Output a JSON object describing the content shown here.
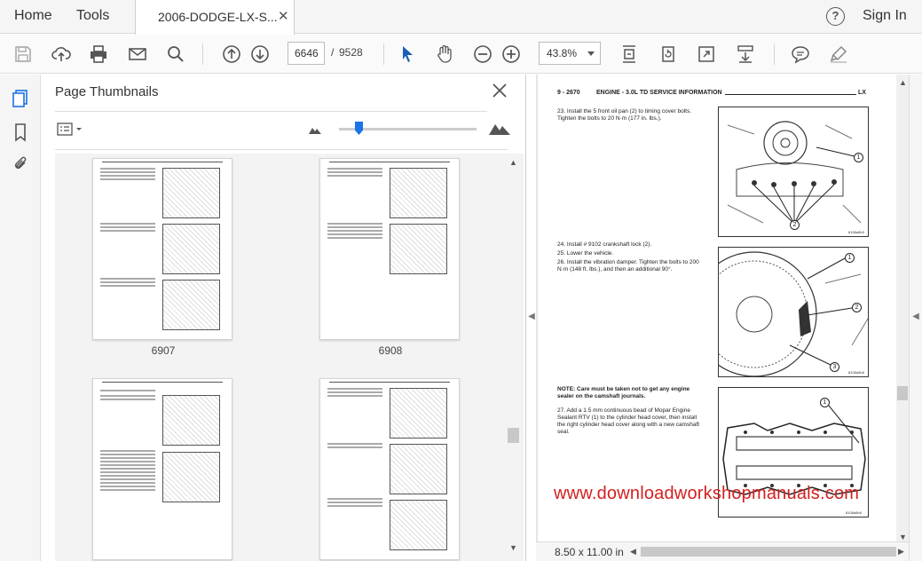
{
  "menubar": {
    "home": "Home",
    "tools": "Tools",
    "tab_title": "2006-DODGE-LX-S...",
    "help_label": "?",
    "sign_in": "Sign In"
  },
  "toolbar": {
    "current_page": "6646",
    "page_separator": "/",
    "page_count": "9528",
    "zoom": "43.8%",
    "icons": [
      "save-icon",
      "upload-icon",
      "print-icon",
      "email-icon",
      "search-icon",
      "page-up-icon",
      "page-down-icon",
      "select-cursor-icon",
      "hand-icon",
      "zoom-out-icon",
      "zoom-in-icon",
      "fit-page-icon",
      "rotate-icon",
      "full-screen-icon",
      "scroll-mode-icon",
      "comment-icon",
      "highlight-icon"
    ]
  },
  "panel": {
    "title": "Page Thumbnails",
    "thumbnails": [
      {
        "label": "6907"
      },
      {
        "label": "6908"
      },
      {
        "label": ""
      },
      {
        "label": ""
      }
    ]
  },
  "document": {
    "header_left": "9 - 2670",
    "header_center": "ENGINE - 3.0L TD SERVICE INFORMATION",
    "header_right": "LX",
    "steps": [
      {
        "text": "23. Install the 5 front oil pan (2) to timing cover bolts. Tighten the bolts to 20 N·m (177 in. lbs.)."
      },
      {
        "text": "24. Install # 9102 crankshaft lock (2)."
      },
      {
        "text": "25. Lower the vehicle."
      },
      {
        "text": "26. Install the vibration damper. Tighten the bolts to 200 N·m (148 ft. lbs.), and then an additional 90°."
      },
      {
        "text": "NOTE: Care must be taken not to get any engine sealer on the camshaft journals."
      },
      {
        "text": "27. Add a 1.5 mm continuous bead of Mopar Engine Sealant RTV (1) to the cylinder head cover, then install the right cylinder head cover along with a new camshaft seal."
      }
    ],
    "figure_codes": [
      "8108a5b9",
      "8108a5b8",
      "8108a5b6"
    ],
    "callouts": [
      "1",
      "2",
      "1",
      "2",
      "3",
      "1"
    ],
    "watermark": "www.downloadworkshopmanuals.com",
    "page_size": "8.50 x 11.00 in"
  }
}
